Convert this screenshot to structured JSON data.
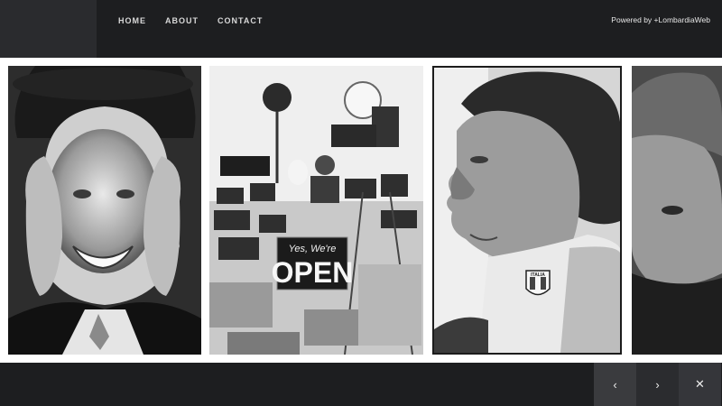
{
  "header": {
    "nav": [
      {
        "label": "HOME"
      },
      {
        "label": "ABOUT"
      },
      {
        "label": "CONTACT"
      }
    ],
    "powered_by": "Powered by +LombardiaWeb"
  },
  "gallery": {
    "photos": [
      {
        "subject": "smiling elderly woman with hat"
      },
      {
        "subject": "photographer with cameras and sign",
        "sign_line1": "Yes, We're",
        "sign_line2": "OPEN"
      },
      {
        "subject": "man in profile with high collar",
        "badge": "ITALIA"
      },
      {
        "subject": "man portrait, partially visible"
      }
    ]
  },
  "controls": {
    "prev_icon": "‹",
    "next_icon": "›",
    "close_icon": "✕"
  },
  "colors": {
    "bar": "#1d1e20",
    "logo_block": "#2a2b2e",
    "background": "#ffffff"
  }
}
